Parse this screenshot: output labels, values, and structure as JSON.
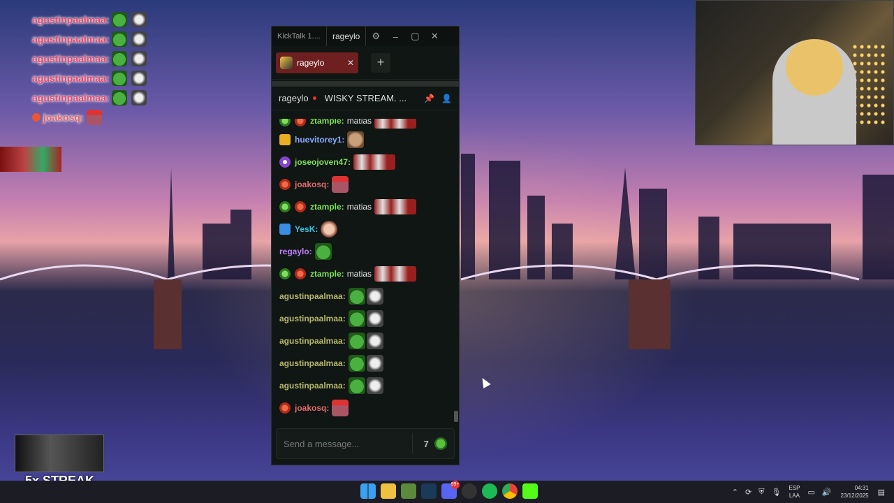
{
  "overlay": {
    "lines": [
      {
        "user": "agustinpaalmaa:"
      },
      {
        "user": "agustinpaalmaa:"
      },
      {
        "user": "agustinpaalmaa:"
      },
      {
        "user": "agustinpaalmaa:"
      },
      {
        "user": "agustinpaalmaa:"
      },
      {
        "user": "joakosq:"
      }
    ],
    "streak_label": "5x STREAK"
  },
  "window": {
    "app_title": "KickTalk 1....",
    "title_channel": "rageylo",
    "active_tab": "rageylo",
    "channel_name": "rageylo",
    "stream_title": "WISKY STREAM. ...",
    "composer_placeholder": "Send a message...",
    "composer_7tv": "7",
    "messages": [
      {
        "user": "ztample:",
        "text": "matias",
        "color": "#7ee05a"
      },
      {
        "user": "huevitorey1:",
        "text": "",
        "color": "#8aa8ff"
      },
      {
        "user": "joseojoven47:",
        "text": "",
        "color": "#7ee05a"
      },
      {
        "user": "joakosq:",
        "text": "",
        "color": "#e06a6a"
      },
      {
        "user": "ztample:",
        "text": "matias",
        "color": "#7ee05a"
      },
      {
        "user": "YesK:",
        "text": "",
        "color": "#3ac0e0"
      },
      {
        "user": "regaylo:",
        "text": "",
        "color": "#c080ff"
      },
      {
        "user": "ztample:",
        "text": "matias",
        "color": "#7ee05a"
      },
      {
        "user": "agustinpaalmaa:",
        "text": "",
        "color": "#b8b86a"
      },
      {
        "user": "agustinpaalmaa:",
        "text": "",
        "color": "#b8b86a"
      },
      {
        "user": "agustinpaalmaa:",
        "text": "",
        "color": "#b8b86a"
      },
      {
        "user": "agustinpaalmaa:",
        "text": "",
        "color": "#b8b86a"
      },
      {
        "user": "agustinpaalmaa:",
        "text": "",
        "color": "#b8b86a"
      },
      {
        "user": "joakosq:",
        "text": "",
        "color": "#e06a6a"
      }
    ]
  },
  "taskbar": {
    "discord_badge": "99+",
    "lang_1": "ESP",
    "lang_2": "LAA",
    "time": "04:31",
    "date": "23/12/2025"
  }
}
